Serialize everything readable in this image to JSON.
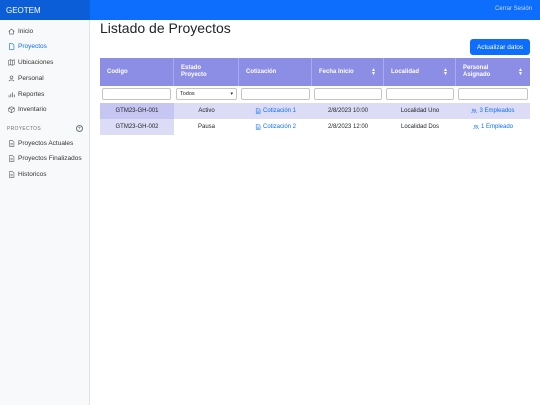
{
  "app": {
    "brand": "GEOTEM",
    "signout": "Cerrar Sesión"
  },
  "sidebar": {
    "items": [
      {
        "label": "Inicio",
        "icon": "home-icon"
      },
      {
        "label": "Proyectos",
        "icon": "file-icon",
        "active": true
      },
      {
        "label": "Ubicaciones",
        "icon": "map-icon"
      },
      {
        "label": "Personal",
        "icon": "user-icon"
      },
      {
        "label": "Reportes",
        "icon": "chart-icon"
      },
      {
        "label": "Inventario",
        "icon": "box-icon"
      }
    ],
    "section_title": "PROYECTOS",
    "section_items": [
      {
        "label": "Proyectos Actuales",
        "icon": "file-icon"
      },
      {
        "label": "Proyectos Finalizados",
        "icon": "file-icon"
      },
      {
        "label": "Historicos",
        "icon": "file-icon"
      }
    ]
  },
  "main": {
    "title": "Listado de Proyectos",
    "refresh_label": "Actualizar datos",
    "columns": [
      {
        "label": "Codigo",
        "sortable": false
      },
      {
        "label": "Estado Proyecto",
        "sortable": false
      },
      {
        "label": "Cotización",
        "sortable": false
      },
      {
        "label": "Fecha Inicio",
        "sortable": true
      },
      {
        "label": "Localidad",
        "sortable": true
      },
      {
        "label": "Personal Asignado",
        "sortable": true
      }
    ],
    "status_filter_value": "Todos",
    "rows": [
      {
        "codigo": "GTM23-GH-001",
        "estado": "Activo",
        "cotizacion": "Cotización 1",
        "fecha": "2/8/2023 10:00",
        "localidad": "Localidad Uno",
        "personal": "3 Empleados"
      },
      {
        "codigo": "GTM23-GH-002",
        "estado": "Pausa",
        "cotizacion": "Cotización 2",
        "fecha": "2/8/2023 12:00",
        "localidad": "Localidad Dos",
        "personal": "1 Empleado"
      }
    ]
  },
  "colors": {
    "primary": "#0d6efd",
    "header": "#8c8ee6",
    "row_highlight": "#dcdcf6",
    "row_code": "#c5c6f2"
  }
}
